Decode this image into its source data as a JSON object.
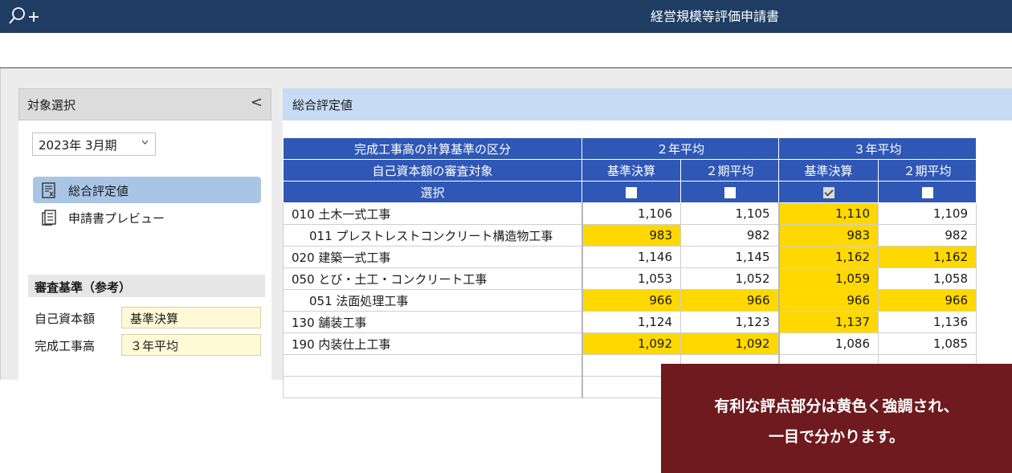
{
  "window": {
    "title": "経営規模等評価申請書",
    "zoom_icon": "zoom-in-icon"
  },
  "left_panel": {
    "header": "対象選択",
    "collapse_label": "<",
    "period": {
      "value": "2023年  3月期",
      "chevron": "chevron-down-icon"
    },
    "nav": [
      {
        "label": "総合評定値",
        "icon": "report-document-icon",
        "active": true
      },
      {
        "label": "申請書プレビュー",
        "icon": "document-preview-icon",
        "active": false
      }
    ],
    "reference": {
      "title": "審査基準（参考）",
      "rows": [
        {
          "label": "自己資本額",
          "value": "基準決算"
        },
        {
          "label": "完成工事高",
          "value": "３年平均"
        }
      ]
    }
  },
  "main": {
    "header": "総合評定値",
    "table": {
      "header_row1": {
        "label": "完成工事高の計算基準の区分",
        "group1": "２年平均",
        "group2": "３年平均"
      },
      "header_row2": {
        "label": "自己資本額の審査対象",
        "cols": [
          "基準決算",
          "２期平均",
          "基準決算",
          "２期平均"
        ]
      },
      "header_row3": {
        "label": "選択",
        "checks": [
          false,
          false,
          true,
          false
        ]
      },
      "rows": [
        {
          "name": "010 土木一式工事",
          "sub": false,
          "values": [
            "1,106",
            "1,105",
            "1,110",
            "1,109"
          ],
          "highlight": [
            false,
            false,
            true,
            false
          ]
        },
        {
          "name": "011 プレストレストコンクリート構造物工事",
          "sub": true,
          "values": [
            "983",
            "982",
            "983",
            "982"
          ],
          "highlight": [
            true,
            false,
            true,
            false
          ]
        },
        {
          "name": "020 建築一式工事",
          "sub": false,
          "values": [
            "1,146",
            "1,145",
            "1,162",
            "1,162"
          ],
          "highlight": [
            false,
            false,
            true,
            true
          ]
        },
        {
          "name": "050 とび・土工・コンクリート工事",
          "sub": false,
          "values": [
            "1,053",
            "1,052",
            "1,059",
            "1,058"
          ],
          "highlight": [
            false,
            false,
            true,
            false
          ]
        },
        {
          "name": "051 法面処理工事",
          "sub": true,
          "values": [
            "966",
            "966",
            "966",
            "966"
          ],
          "highlight": [
            true,
            true,
            true,
            true
          ]
        },
        {
          "name": "130 舗装工事",
          "sub": false,
          "values": [
            "1,124",
            "1,123",
            "1,137",
            "1,136"
          ],
          "highlight": [
            false,
            false,
            true,
            false
          ]
        },
        {
          "name": "190 内装仕上工事",
          "sub": false,
          "values": [
            "1,092",
            "1,092",
            "1,086",
            "1,085"
          ],
          "highlight": [
            true,
            true,
            false,
            false
          ]
        }
      ]
    }
  },
  "callout": {
    "line1": "有利な評点部分は黄色く強調され、",
    "line2": "一目で分かります。"
  },
  "colors": {
    "titlebar": "#1f3d63",
    "header_blue": "#2f57b5",
    "highlight": "#ffd800",
    "callout": "#6e1a1e",
    "active_nav": "#a9c5e6"
  }
}
